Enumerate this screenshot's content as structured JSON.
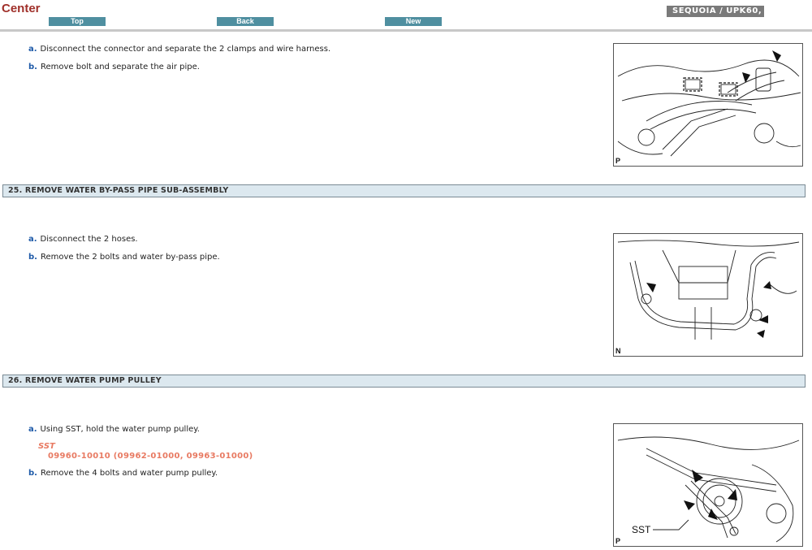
{
  "header": {
    "title": "Center",
    "nav": {
      "top": "Top",
      "back": "Back",
      "new": "New"
    },
    "model": "SEQUOIA / UPK60,"
  },
  "section24": {
    "steps": [
      {
        "letter": "a.",
        "text": "Disconnect the connector and separate the 2 clamps and wire harness."
      },
      {
        "letter": "b.",
        "text": "Remove bolt and separate the air pipe."
      }
    ],
    "figure_label": "P"
  },
  "section25": {
    "heading": "25. REMOVE WATER BY-PASS PIPE SUB-ASSEMBLY",
    "steps": [
      {
        "letter": "a.",
        "text": "Disconnect the 2 hoses."
      },
      {
        "letter": "b.",
        "text": "Remove the 2 bolts and water by-pass pipe."
      }
    ],
    "figure_label": "N"
  },
  "section26": {
    "heading": "26. REMOVE WATER PUMP PULLEY",
    "steps": [
      {
        "letter": "a.",
        "text": "Using SST, hold the water pump pulley."
      },
      {
        "letter": "b.",
        "text": "Remove the 4 bolts and water pump pulley."
      }
    ],
    "sst_label": "SST",
    "sst_code": "09960-10010   (09962-01000, 09963-01000)",
    "figure_callout": "SST",
    "figure_label": "P"
  }
}
